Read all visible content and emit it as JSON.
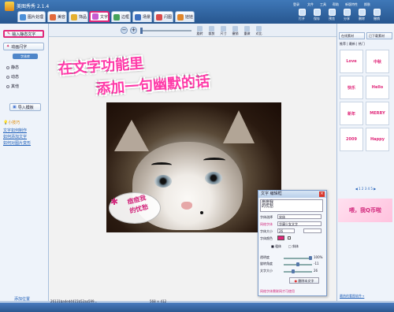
{
  "window": {
    "title": "美图秀秀 2.1.4",
    "menu": [
      "登录",
      "文件",
      "工具",
      "帮助",
      "新版特性",
      "换肤"
    ]
  },
  "tabs": [
    "图片处理",
    "美容",
    "饰品",
    "文字",
    "边框",
    "场景",
    "闪图",
    "娃娃"
  ],
  "toolbar": [
    "打开",
    "保存",
    "预览",
    "分享",
    "删除",
    "撤销"
  ],
  "left_panel": {
    "primary_button": "输入静态文字",
    "animated_button": "动画闪字",
    "font_select": "字体库",
    "radio_options": [
      "静态",
      "动态",
      "其他"
    ],
    "import_button": "导入模板",
    "tips_title": "小技巧",
    "tip_links": [
      "文字如何制作",
      "如何添加文字",
      "如何对图片变形"
    ],
    "bottom_link": "添加位置"
  },
  "canvas_toolbar": {
    "tools": [
      "旋转",
      "裁剪",
      "尺寸",
      "撤销",
      "重做",
      "对比"
    ]
  },
  "headline": {
    "line1": "在文字功能里",
    "line2": "添加一句幽默的话"
  },
  "bubble_text": {
    "line1": "痘痘我",
    "line2": "的忧愁"
  },
  "dialog": {
    "title": "文字 编辑框",
    "text": "痘痘我\n的忧愁",
    "font_label": "字体选择",
    "font_value": "宋体",
    "style_label": "网络字体",
    "style_value": "华康少女文字",
    "size_label": "字体大小",
    "size_value": "26",
    "color_label": "字体颜色",
    "bold": "粗体",
    "italic": "斜体",
    "opacity_label": "透明度",
    "opacity_value": "100%",
    "rotate_label": "旋转角度",
    "rotate_value": "-11",
    "size2_label": "文字大小",
    "size2_value": "26",
    "delete_button": "删除本文字",
    "footer": "网络字体需联网才可使用"
  },
  "right_panel": {
    "tabs": [
      "在线素材",
      "已下载素材"
    ],
    "filter": [
      "推荐",
      "最新",
      "热门"
    ],
    "thumbs": [
      "Love",
      "中秋",
      "快乐",
      "Hello",
      "新年",
      "MERRY",
      "2009",
      "Happy"
    ],
    "banner": "喂，我Q币啦",
    "footer": "最热的看图软件→"
  },
  "status": {
    "filename": "26131ba4ed4415b52aa599...",
    "size": "568 × 412"
  }
}
